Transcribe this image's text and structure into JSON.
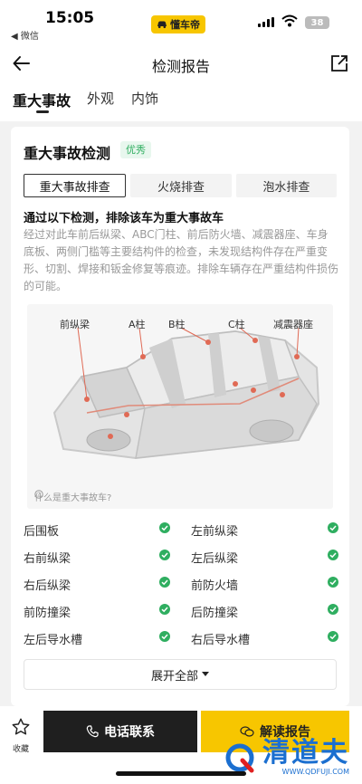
{
  "status_bar": {
    "time": "15:05",
    "back_app": "◀ 微信",
    "brand": "懂车帝",
    "battery": "38"
  },
  "nav": {
    "title": "检测报告"
  },
  "tabs": [
    {
      "label": "重大事故"
    },
    {
      "label": "外观"
    },
    {
      "label": "内饰"
    }
  ],
  "card": {
    "title": "重大事故检测",
    "badge": "优秀",
    "subtabs": [
      {
        "label": "重大事故排查"
      },
      {
        "label": "火烧排查"
      },
      {
        "label": "泡水排查"
      }
    ],
    "headline": "通过以下检测，排除该车为重大事故车",
    "description": "经过对此车前后纵梁、ABC门柱、前后防火墙、减震器座、车身底板、两侧门槛等主要结构件的检查，未发现结构件存在严重变形、切割、焊接和钣金修复等痕迹。排除车辆存在严重结构件损伤的可能。",
    "part_labels": [
      "前纵梁",
      "A柱",
      "B柱",
      "C柱",
      "减震器座"
    ],
    "what_is": "什么是重大事故车?",
    "checks": [
      "后围板",
      "左前纵梁",
      "右前纵梁",
      "左后纵梁",
      "右后纵梁",
      "前防火墙",
      "前防撞梁",
      "后防撞梁",
      "左后导水槽",
      "右后导水槽"
    ],
    "expand_label": "展开全部"
  },
  "bottom": {
    "fav_label": "收藏",
    "call_label": "电话联系",
    "report_label": "解读报告"
  },
  "watermark": {
    "cn": "清道夫",
    "en": "WWW.QDFUJI.COM"
  },
  "colors": {
    "accent": "#f7c600",
    "ok": "#2fae60",
    "dark": "#1f1f1f"
  }
}
